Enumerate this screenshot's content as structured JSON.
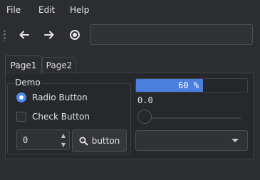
{
  "menubar": {
    "items": [
      "File",
      "Edit",
      "Help"
    ]
  },
  "toolbar": {
    "back_icon": "arrow-left-icon",
    "forward_icon": "arrow-right-icon",
    "record_icon": "record-icon",
    "address_value": ""
  },
  "tabs": [
    {
      "label": "Page1",
      "active": true
    },
    {
      "label": "Page2",
      "active": false
    }
  ],
  "demo": {
    "group_title": "Demo",
    "radio_label": "Radio Button",
    "radio_checked": true,
    "check_label": "Check Button",
    "check_checked": false,
    "spin_value": "0",
    "button_label": "button",
    "button_icon": "search-icon"
  },
  "controls": {
    "progress_percent": 60,
    "progress_text": "60 %",
    "value_readout": "0.0",
    "slider_value": 0,
    "combo_value": ""
  },
  "colors": {
    "accent": "#4a7fe0",
    "background": "#2b2d30",
    "panel": "#26282b"
  }
}
